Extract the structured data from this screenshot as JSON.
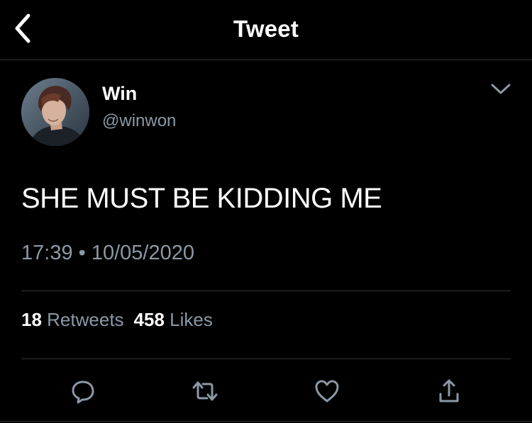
{
  "header": {
    "title": "Tweet",
    "back_icon": "chevron-left-icon"
  },
  "tweet": {
    "author": {
      "display_name": "Win",
      "handle": "@winwon"
    },
    "text": "SHE MUST BE KIDDING ME",
    "time": "17:39",
    "separator": "•",
    "date": "10/05/2020",
    "more_icon": "chevron-down-icon"
  },
  "stats": {
    "retweets": {
      "count": "18",
      "label": "Retweets"
    },
    "likes": {
      "count": "458",
      "label": "Likes"
    }
  },
  "actions": [
    {
      "icon": "reply-icon"
    },
    {
      "icon": "retweet-icon"
    },
    {
      "icon": "like-icon"
    },
    {
      "icon": "share-icon"
    }
  ],
  "colors": {
    "background": "#000000",
    "primary_text": "#ffffff",
    "secondary_text": "#8b98a5",
    "divider": "#2f3336"
  }
}
